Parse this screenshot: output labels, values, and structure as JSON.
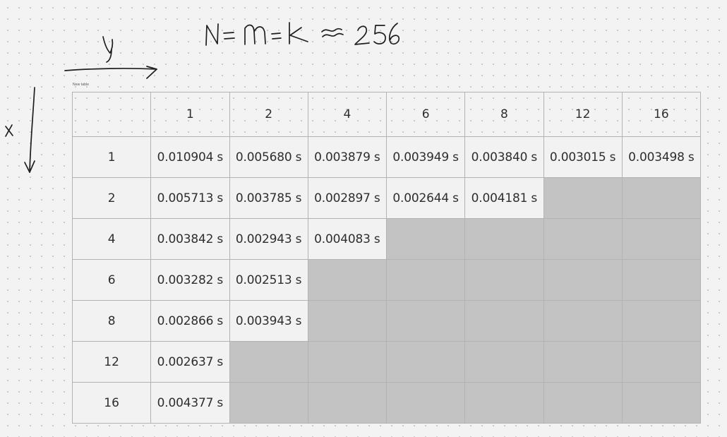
{
  "canvas": {
    "table": {
      "title": "New table",
      "header_row": [
        "",
        "1",
        "2",
        "4",
        "6",
        "8",
        "12",
        "16"
      ],
      "rows": [
        {
          "label": "1",
          "cells": [
            "0.010904 s",
            "0.005680 s",
            "0.003879 s",
            "0.003949 s",
            "0.003840 s",
            "0.003015 s",
            "0.003498 s"
          ]
        },
        {
          "label": "2",
          "cells": [
            "0.005713 s",
            "0.003785 s",
            "0.002897 s",
            "0.002644 s",
            "0.004181 s",
            "",
            ""
          ]
        },
        {
          "label": "4",
          "cells": [
            "0.003842 s",
            "0.002943 s",
            "0.004083 s",
            "",
            "",
            "",
            ""
          ]
        },
        {
          "label": "6",
          "cells": [
            "0.003282 s",
            "0.002513 s",
            "",
            "",
            "",
            "",
            ""
          ]
        },
        {
          "label": "8",
          "cells": [
            "0.002866 s",
            "0.003943 s",
            "",
            "",
            "",
            "",
            ""
          ]
        },
        {
          "label": "12",
          "cells": [
            "0.002637 s",
            "",
            "",
            "",
            "",
            "",
            ""
          ]
        },
        {
          "label": "16",
          "cells": [
            "0.004377 s",
            "",
            "",
            "",
            "",
            "",
            ""
          ]
        }
      ],
      "empty_cell_color": "#c3c3c3",
      "filled_cell_color": "#f2f2f2"
    },
    "annotations": {
      "formula": "N = m = k ≈ 256",
      "y_axis_label": "y",
      "x_axis_label": "x"
    }
  }
}
